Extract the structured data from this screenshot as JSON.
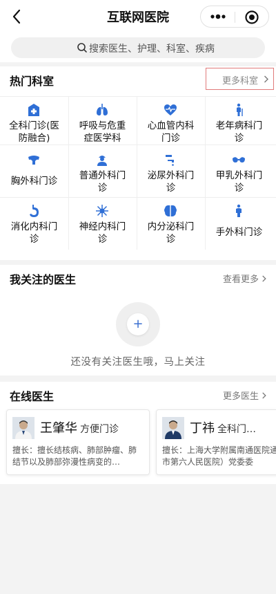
{
  "header": {
    "title": "互联网医院",
    "back_icon": "chevron-left-icon",
    "menu_icon": "more-dots-icon",
    "close_icon": "target-circle-icon"
  },
  "search": {
    "placeholder": "搜索医生、护理、科室、疾病"
  },
  "hot_departments": {
    "title": "热门科室",
    "more_label": "更多科室",
    "items": [
      {
        "line1": "全科门诊(医",
        "line2": "防融合)",
        "icon": "hospital-icon"
      },
      {
        "line1": "呼吸与危重",
        "line2": "症医学科",
        "icon": "lungs-icon"
      },
      {
        "line1": "心血管内科",
        "line2": "门诊",
        "icon": "heart-pulse-icon"
      },
      {
        "line1": "老年病科门",
        "line2": "诊",
        "icon": "elderly-icon"
      },
      {
        "line1": "胸外科门诊",
        "line2": "",
        "icon": "chest-icon"
      },
      {
        "line1": "普通外科门",
        "line2": "诊",
        "icon": "surgeon-icon"
      },
      {
        "line1": "泌尿外科门",
        "line2": "诊",
        "icon": "faucet-icon"
      },
      {
        "line1": "甲乳外科门",
        "line2": "诊",
        "icon": "bra-icon"
      },
      {
        "line1": "消化内科门",
        "line2": "诊",
        "icon": "stomach-icon"
      },
      {
        "line1": "神经内科门",
        "line2": "诊",
        "icon": "neuron-icon"
      },
      {
        "line1": "内分泌科门",
        "line2": "诊",
        "icon": "brain-icon"
      },
      {
        "line1": "手外科门诊",
        "line2": "",
        "icon": "hand-person-icon"
      }
    ]
  },
  "followed_doctors": {
    "title": "我关注的医生",
    "more_label": "查看更多",
    "empty_text": "还没有关注医生哦，马上关注",
    "add_symbol": "+"
  },
  "online_doctors": {
    "title": "在线医生",
    "more_label": "更多医生",
    "doctors": [
      {
        "name": "王肇华",
        "dept": "方便门诊",
        "specialty": "擅长：擅长结核病、肺部肿瘤、肺结节以及肺部弥漫性病变的…"
      },
      {
        "name": "丁祎",
        "dept": "全科门…",
        "specialty": "擅长：上海大学附属南通医院通市第六人民医院）党委委"
      }
    ]
  },
  "colors": {
    "accent_blue": "#2f6fd6",
    "highlight_border": "#e07a7a"
  }
}
